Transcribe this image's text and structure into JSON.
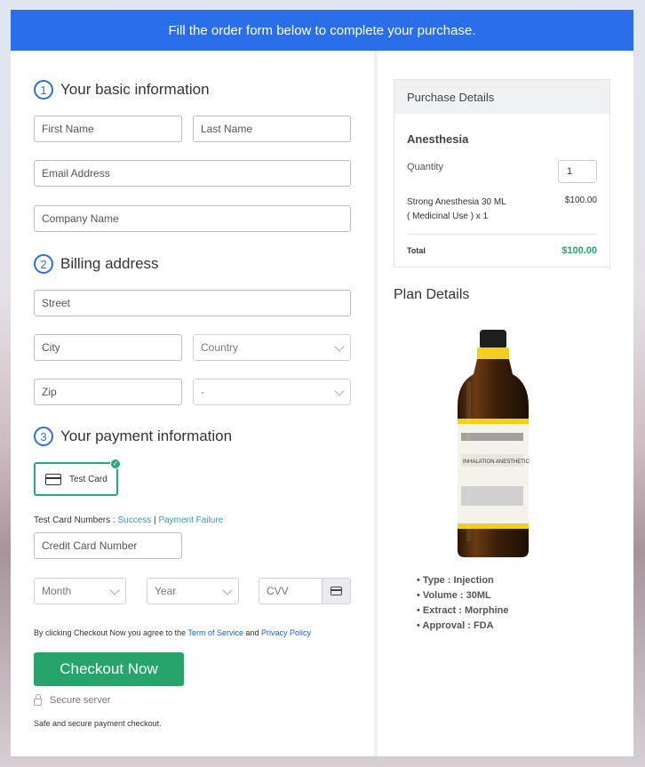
{
  "banner": {
    "text": "Fill the order form below to complete your purchase."
  },
  "sections": {
    "basic": {
      "num": "1",
      "title": "Your basic information"
    },
    "billing": {
      "num": "2",
      "title": "Billing address"
    },
    "payment": {
      "num": "3",
      "title": "Your payment information"
    }
  },
  "fields": {
    "first_name": "First Name",
    "last_name": "Last Name",
    "email": "Email Address",
    "company": "Company Name",
    "street": "Street",
    "city": "City",
    "country": "Country",
    "zip": "Zip",
    "state": "-",
    "card_number": "Credit Card Number",
    "month": "Month",
    "year": "Year",
    "cvv": "CVV"
  },
  "payment": {
    "test_card_label": "Test Card",
    "test_numbers_prefix": "Test Card Numbers : ",
    "success": "Success",
    "sep": " | ",
    "failure": "Payment Failure"
  },
  "agreement": {
    "prefix": "By clicking Checkout Now you agree to the ",
    "terms": "Term of Service",
    "and": " and ",
    "privacy": "Privacy Policy"
  },
  "checkout": {
    "button": "Checkout Now",
    "secure": "Secure server",
    "safe": "Safe and secure payment checkout."
  },
  "purchase": {
    "heading": "Purchase Details",
    "product": "Anesthesia",
    "quantity_label": "Quantity",
    "quantity_value": "1",
    "item_line1": "Strong Anesthesia 30 ML",
    "item_line2": "( Medicinal Use ) x 1",
    "item_price": "$100.00",
    "total_label": "Total",
    "total_value": "$100.00"
  },
  "plan": {
    "title": "Plan Details",
    "bottle_label": "INHALATION ANESTHETIC",
    "items": [
      "Type : Injection",
      "Volume : 30ML",
      "Extract : Morphine",
      "Approval : FDA"
    ]
  },
  "colors": {
    "accent": "#2a6fe9",
    "button": "#27a46b",
    "total": "#27a46b",
    "link": "#1d5fd1",
    "test_link": "#27a0b8"
  },
  "icons": [
    "card-icon",
    "check-icon",
    "chevron-down-icon",
    "lock-icon",
    "cvv-card-icon"
  ]
}
